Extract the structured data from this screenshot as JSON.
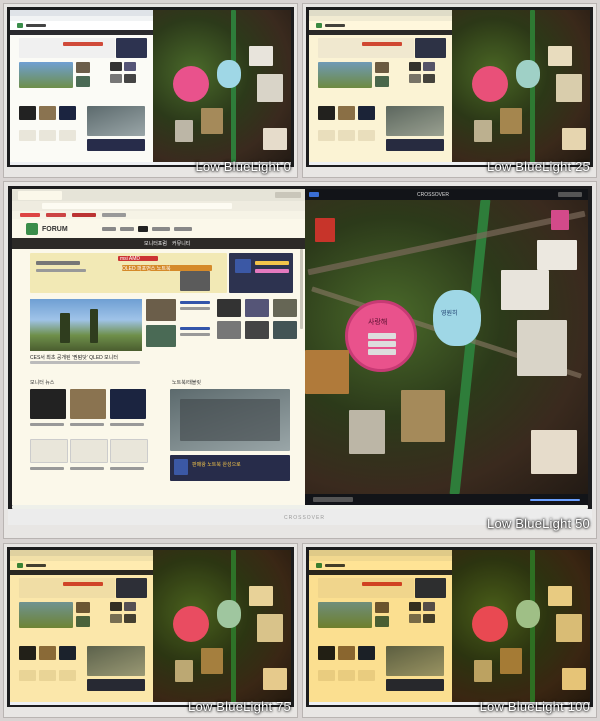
{
  "panels": [
    {
      "caption": "Low BlueLight 0",
      "tint": "#ffffff"
    },
    {
      "caption": "Low BlueLight 25",
      "tint": "#fff6d8"
    },
    {
      "caption": "Low BlueLight 50",
      "tint": "#fff3cc"
    },
    {
      "caption": "Low BlueLight 75",
      "tint": "#ffe9a8"
    },
    {
      "caption": "Low BlueLight 100",
      "tint": "#ffe08a"
    }
  ],
  "monitor": {
    "brand": "CROSSOVER"
  },
  "browser": {
    "site_logo": "FORUM",
    "nav_items": [
      "모니터포럼",
      "커뮤니티"
    ],
    "banner_text": "OLED 퍼포먼스 노트북",
    "banner_sub": "msi AMD",
    "promo_text": "완성도 높은 노트북",
    "headline_caption": "CES서 최초 공개된 '퀀텀닷' QLED 모니터",
    "section_left": "모니터 뉴스",
    "section_right": "노트북/태블릿",
    "footer_banner": "판매왕 노트북 완성으로"
  },
  "viewer": {
    "title": "CROSSOVER"
  },
  "lock_texts": {
    "pink": "사랑해",
    "cyan": "영원히"
  }
}
